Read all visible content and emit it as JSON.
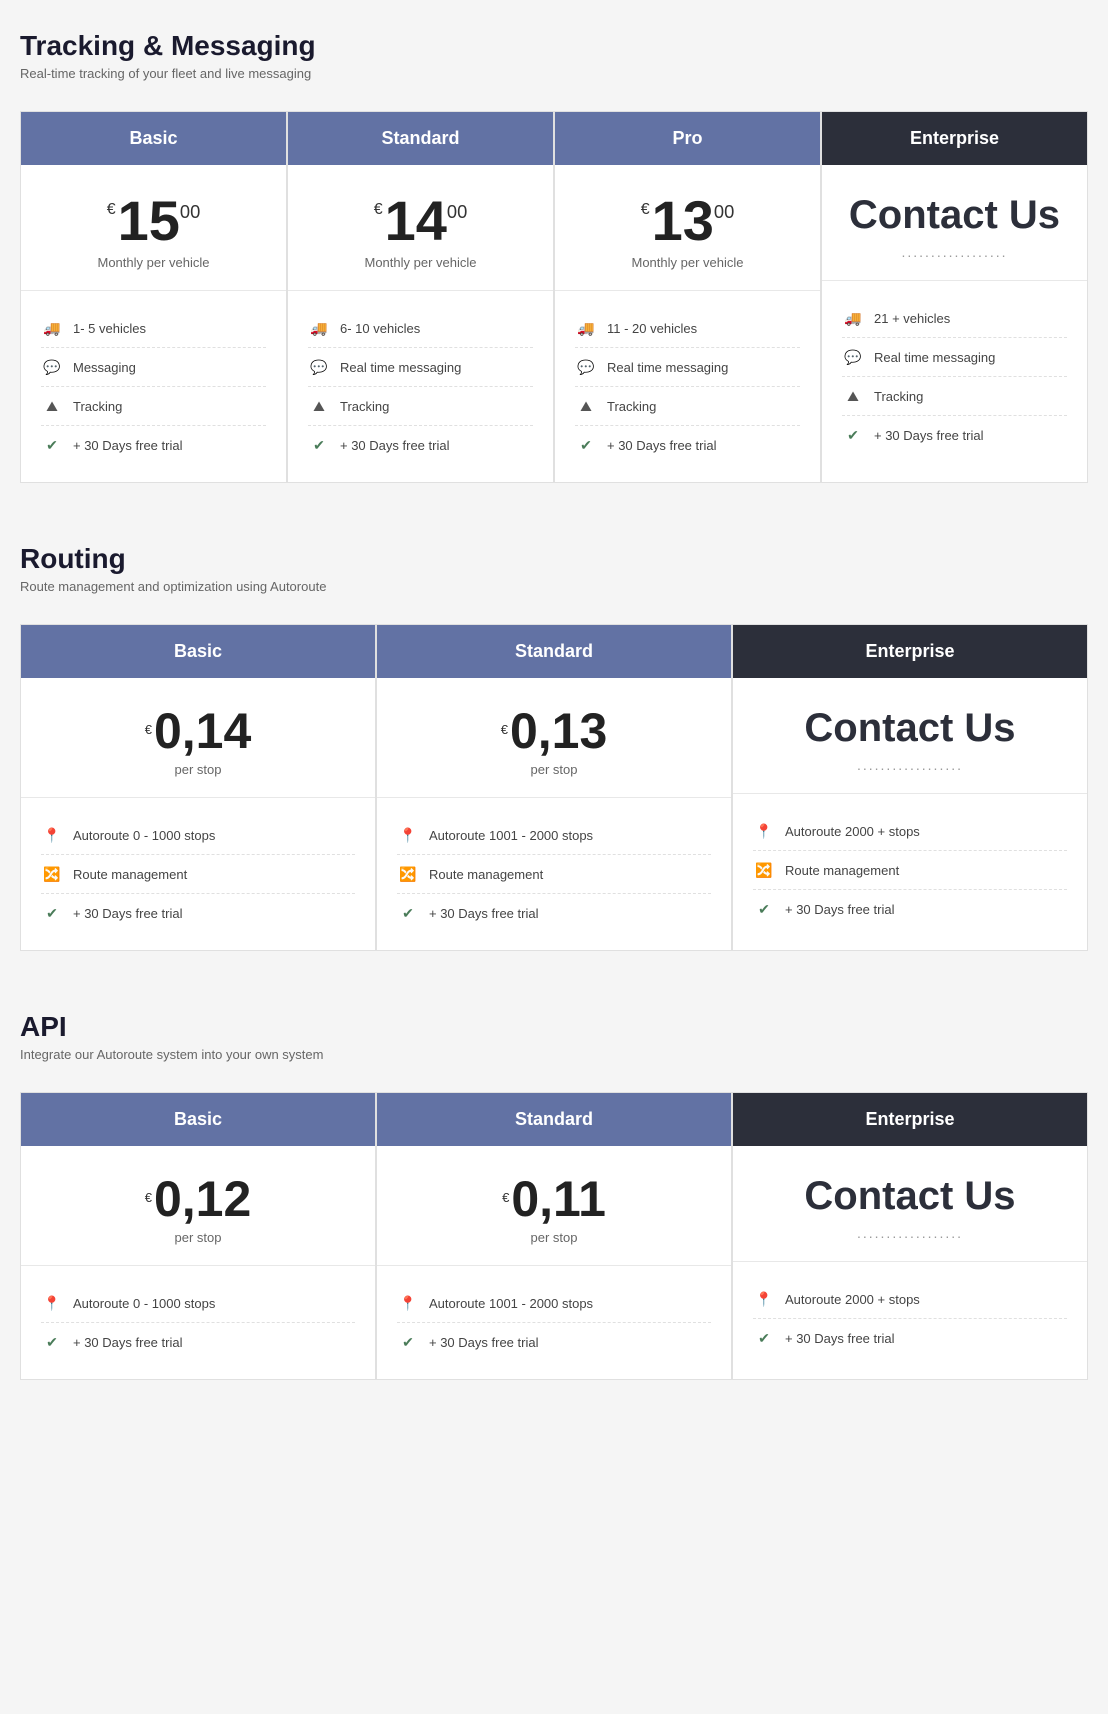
{
  "tracking": {
    "title": "Tracking & Messaging",
    "subtitle": "Real-time tracking of your fleet and live messaging",
    "plans": [
      {
        "name": "Basic",
        "type": "blue",
        "price_currency": "€",
        "price_main": "15",
        "price_decimal": "00",
        "price_label": "Monthly per vehicle",
        "features": [
          {
            "icon": "truck",
            "text": "1- 5 vehicles"
          },
          {
            "icon": "chat",
            "text": "Messaging"
          },
          {
            "icon": "tracking",
            "text": "Tracking"
          },
          {
            "icon": "check",
            "text": "+ 30 Days free trial"
          }
        ]
      },
      {
        "name": "Standard",
        "type": "blue",
        "price_currency": "€",
        "price_main": "14",
        "price_decimal": "00",
        "price_label": "Monthly per vehicle",
        "features": [
          {
            "icon": "truck",
            "text": "6- 10 vehicles"
          },
          {
            "icon": "chat",
            "text": "Real time messaging"
          },
          {
            "icon": "tracking",
            "text": "Tracking"
          },
          {
            "icon": "check",
            "text": "+ 30 Days free trial"
          }
        ]
      },
      {
        "name": "Pro",
        "type": "blue",
        "price_currency": "€",
        "price_main": "13",
        "price_decimal": "00",
        "price_label": "Monthly per vehicle",
        "features": [
          {
            "icon": "truck",
            "text": "11 - 20 vehicles"
          },
          {
            "icon": "chat",
            "text": "Real time messaging"
          },
          {
            "icon": "tracking",
            "text": "Tracking"
          },
          {
            "icon": "check",
            "text": "+ 30 Days free trial"
          }
        ]
      },
      {
        "name": "Enterprise",
        "type": "dark",
        "contact": true,
        "contact_text": "Contact Us",
        "contact_dots": "..................",
        "features": [
          {
            "icon": "truck",
            "text": "21 + vehicles"
          },
          {
            "icon": "chat",
            "text": "Real time messaging"
          },
          {
            "icon": "tracking",
            "text": "Tracking"
          },
          {
            "icon": "check",
            "text": "+ 30 Days free trial"
          }
        ]
      }
    ]
  },
  "routing": {
    "title": "Routing",
    "subtitle": "Route management and optimization using Autoroute",
    "plans": [
      {
        "name": "Basic",
        "type": "blue",
        "price_currency": "€",
        "price_main": "0,14",
        "price_label": "per stop",
        "features": [
          {
            "icon": "pin",
            "text": "Autoroute 0 - 1000 stops"
          },
          {
            "icon": "route",
            "text": "Route management"
          },
          {
            "icon": "check",
            "text": "+ 30 Days free trial"
          }
        ]
      },
      {
        "name": "Standard",
        "type": "blue",
        "price_currency": "€",
        "price_main": "0,13",
        "price_label": "per stop",
        "features": [
          {
            "icon": "pin",
            "text": "Autoroute 1001 - 2000 stops"
          },
          {
            "icon": "route",
            "text": "Route management"
          },
          {
            "icon": "check",
            "text": "+ 30 Days free trial"
          }
        ]
      },
      {
        "name": "Enterprise",
        "type": "dark",
        "contact": true,
        "contact_text": "Contact Us",
        "contact_dots": "..................",
        "features": [
          {
            "icon": "pin",
            "text": "Autoroute 2000 + stops"
          },
          {
            "icon": "route",
            "text": "Route management"
          },
          {
            "icon": "check",
            "text": "+ 30 Days free trial"
          }
        ]
      }
    ]
  },
  "api": {
    "title": "API",
    "subtitle": "Integrate our Autoroute system into your own system",
    "plans": [
      {
        "name": "Basic",
        "type": "blue",
        "price_currency": "€",
        "price_main": "0,12",
        "price_label": "per stop",
        "features": [
          {
            "icon": "pin",
            "text": "Autoroute 0 - 1000 stops"
          },
          {
            "icon": "check",
            "text": "+ 30 Days free trial"
          }
        ]
      },
      {
        "name": "Standard",
        "type": "blue",
        "price_currency": "€",
        "price_main": "0,11",
        "price_label": "per stop",
        "features": [
          {
            "icon": "pin",
            "text": "Autoroute 1001 - 2000 stops"
          },
          {
            "icon": "check",
            "text": "+ 30 Days free trial"
          }
        ]
      },
      {
        "name": "Enterprise",
        "type": "dark",
        "contact": true,
        "contact_text": "Contact Us",
        "contact_dots": "..................",
        "features": [
          {
            "icon": "pin",
            "text": "Autoroute 2000 + stops"
          },
          {
            "icon": "check",
            "text": "+ 30 Days free trial"
          }
        ]
      }
    ]
  },
  "icons": {
    "truck": "🚚",
    "chat": "💬",
    "tracking": "🏔",
    "check": "✅",
    "pin": "📍",
    "route": "🔀"
  }
}
